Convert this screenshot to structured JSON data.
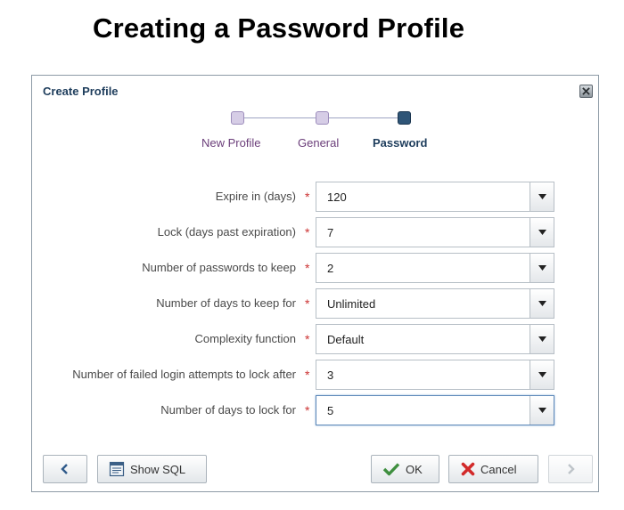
{
  "slide": {
    "title": "Creating a Password Profile"
  },
  "dialog": {
    "title": "Create Profile",
    "train": [
      {
        "label": "New Profile",
        "state": "visited"
      },
      {
        "label": "General",
        "state": "visited"
      },
      {
        "label": "Password",
        "state": "current"
      }
    ],
    "fields": [
      {
        "label": "Expire in (days)",
        "value": "120"
      },
      {
        "label": "Lock (days past expiration)",
        "value": "7"
      },
      {
        "label": "Number of passwords to keep",
        "value": "2"
      },
      {
        "label": "Number of days to keep for",
        "value": "Unlimited"
      },
      {
        "label": "Complexity function",
        "value": "Default"
      },
      {
        "label": "Number of failed login attempts to lock after",
        "value": "3"
      },
      {
        "label": "Number of days to lock for",
        "value": "5"
      }
    ],
    "required_mark": "*",
    "buttons": {
      "show_sql": "Show SQL",
      "ok": "OK",
      "cancel": "Cancel"
    }
  },
  "colors": {
    "accent": "#2f5577",
    "visited": "#6b3e7a",
    "required": "#cc3333",
    "ok_check": "#3f8f3f",
    "cancel_x": "#d22a2a"
  }
}
